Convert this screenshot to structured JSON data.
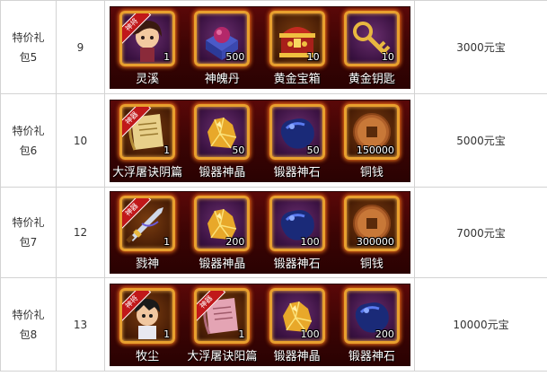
{
  "packages": [
    {
      "name_line1": "特价礼",
      "name_line2": "包5",
      "level": "9",
      "price": "3000元宝",
      "items": [
        {
          "label": "灵溪",
          "count": "1",
          "badge": "神将",
          "icon": "heroine-portrait-icon",
          "frame": "purple"
        },
        {
          "label": "神魄丹",
          "count": "500",
          "icon": "pill-box-icon",
          "frame": "purple"
        },
        {
          "label": "黄金宝箱",
          "count": "10",
          "icon": "gold-treasure-chest-icon",
          "frame": "orange"
        },
        {
          "label": "黄金钥匙",
          "count": "10",
          "icon": "gold-key-icon",
          "frame": "purple"
        }
      ]
    },
    {
      "name_line1": "特价礼",
      "name_line2": "包6",
      "level": "10",
      "price": "5000元宝",
      "items": [
        {
          "label": "大浮屠诀阴篇",
          "count": "1",
          "badge": "神器",
          "icon": "scroll-icon",
          "frame": "orange"
        },
        {
          "label": "锻器神晶",
          "count": "50",
          "icon": "gold-crystal-icon",
          "frame": "purple"
        },
        {
          "label": "锻器神石",
          "count": "50",
          "icon": "blue-stone-icon",
          "frame": "purple"
        },
        {
          "label": "铜钱",
          "count": "150000",
          "icon": "copper-coin-icon",
          "frame": "orange"
        }
      ]
    },
    {
      "name_line1": "特价礼",
      "name_line2": "包7",
      "level": "12",
      "price": "7000元宝",
      "items": [
        {
          "label": "戮神",
          "count": "1",
          "badge": "神器",
          "icon": "sword-icon",
          "frame": "orange"
        },
        {
          "label": "锻器神晶",
          "count": "200",
          "icon": "gold-crystal-icon",
          "frame": "purple"
        },
        {
          "label": "锻器神石",
          "count": "100",
          "icon": "blue-stone-icon",
          "frame": "purple"
        },
        {
          "label": "铜钱",
          "count": "300000",
          "icon": "copper-coin-icon",
          "frame": "orange"
        }
      ]
    },
    {
      "name_line1": "特价礼",
      "name_line2": "包8",
      "level": "13",
      "price": "10000元宝",
      "items": [
        {
          "label": "牧尘",
          "count": "1",
          "badge": "神将",
          "icon": "hero-portrait-icon",
          "frame": "orange"
        },
        {
          "label": "大浮屠诀阳篇",
          "count": "1",
          "badge": "神器",
          "icon": "pink-scroll-icon",
          "frame": "orange"
        },
        {
          "label": "锻器神晶",
          "count": "100",
          "icon": "gold-crystal-icon",
          "frame": "purple"
        },
        {
          "label": "锻器神石",
          "count": "200",
          "icon": "blue-stone-icon",
          "frame": "purple"
        }
      ]
    }
  ],
  "colors": {
    "strip_bg": "#3a0404",
    "frame_border": "#e8a02e",
    "glow": "#ff7a1a",
    "badge_red": "#c0181a",
    "table_border": "#d3d3d3"
  }
}
